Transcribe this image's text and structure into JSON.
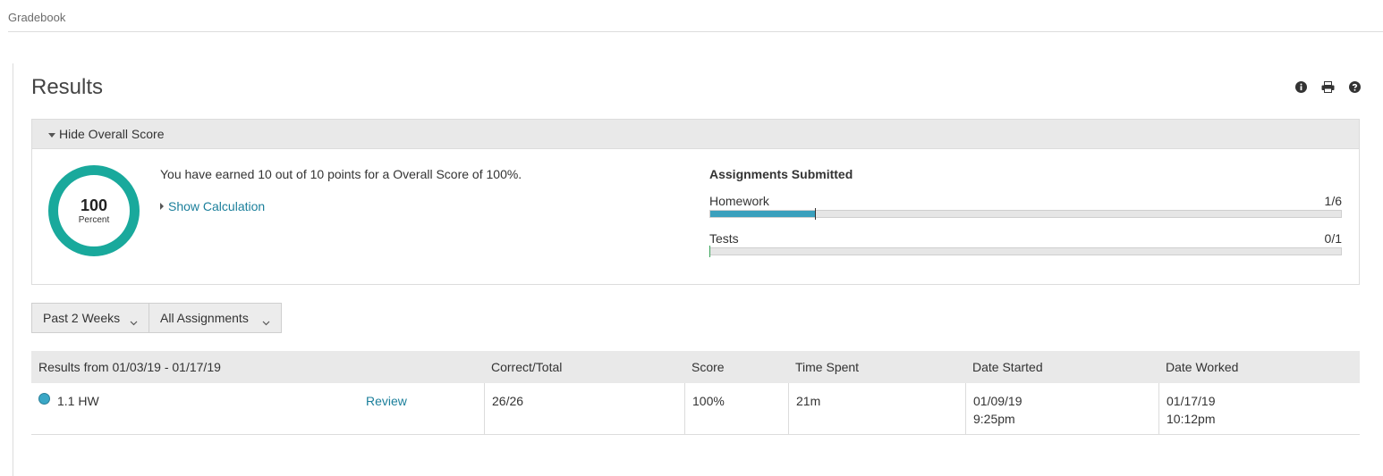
{
  "breadcrumb": {
    "label": "Gradebook"
  },
  "page": {
    "title": "Results"
  },
  "toolbar": {
    "icons": [
      "info-icon",
      "print-icon",
      "help-icon"
    ]
  },
  "overall": {
    "toggle_label": "Hide Overall Score",
    "score_value": "100",
    "score_unit": "Percent",
    "score_percent": 100,
    "earned_text": "You have earned 10 out of 10 points for a Overall Score of 100%.",
    "show_calc_label": "Show Calculation",
    "ring_color": "#19a99c"
  },
  "submitted": {
    "title": "Assignments Submitted",
    "items": [
      {
        "label": "Homework",
        "count": "1/6",
        "fraction": 0.1667,
        "fill_color": "#3aa0bd"
      },
      {
        "label": "Tests",
        "count": "0/1",
        "fraction": 0.0,
        "fill_color": "#3aa35a"
      }
    ]
  },
  "filters": {
    "period": "Past 2 Weeks",
    "assignments": "All Assignments"
  },
  "table": {
    "range_header": "Results from 01/03/19 - 01/17/19",
    "columns": [
      "Correct/Total",
      "Score",
      "Time Spent",
      "Date Started",
      "Date Worked"
    ],
    "rows": [
      {
        "name": "1.1 HW",
        "action": "Review",
        "correct_total": "26/26",
        "score": "100%",
        "time_spent": "21m",
        "date_started": "01/09/19",
        "time_started": "9:25pm",
        "date_worked": "01/17/19",
        "time_worked": "10:12pm",
        "status_color": "#3aa7c6"
      }
    ]
  },
  "colors": {
    "link": "#1b7f9b",
    "header_bg": "#e9e9e9"
  }
}
